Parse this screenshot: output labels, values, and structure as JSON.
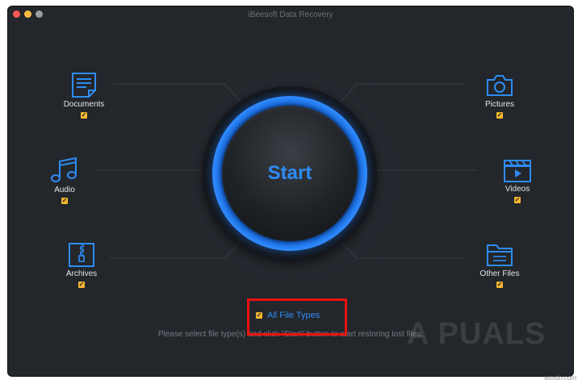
{
  "window": {
    "title": "iBeesoft Data Recovery"
  },
  "start": {
    "label": "Start"
  },
  "categories": [
    {
      "label": "Documents",
      "icon": "document-icon",
      "checked": true
    },
    {
      "label": "Audio",
      "icon": "music-note-icon",
      "checked": true
    },
    {
      "label": "Archives",
      "icon": "archive-icon",
      "checked": true
    },
    {
      "label": "Pictures",
      "icon": "camera-icon",
      "checked": true
    },
    {
      "label": "Videos",
      "icon": "clapperboard-icon",
      "checked": true
    },
    {
      "label": "Other Files",
      "icon": "folder-icon",
      "checked": true
    }
  ],
  "all_file_types": {
    "label": "All File Types",
    "checked": true
  },
  "hint": "Please select file type(s) and click \"Start\" button to start restoring lost files.",
  "watermark": "A PUALS",
  "credit": "wsxdn.com",
  "colors": {
    "window_bg": "#23262b",
    "accent_blue": "#2e8cf4",
    "checkbox_yellow": "#f2b62f",
    "highlight_red": "#e81212"
  }
}
